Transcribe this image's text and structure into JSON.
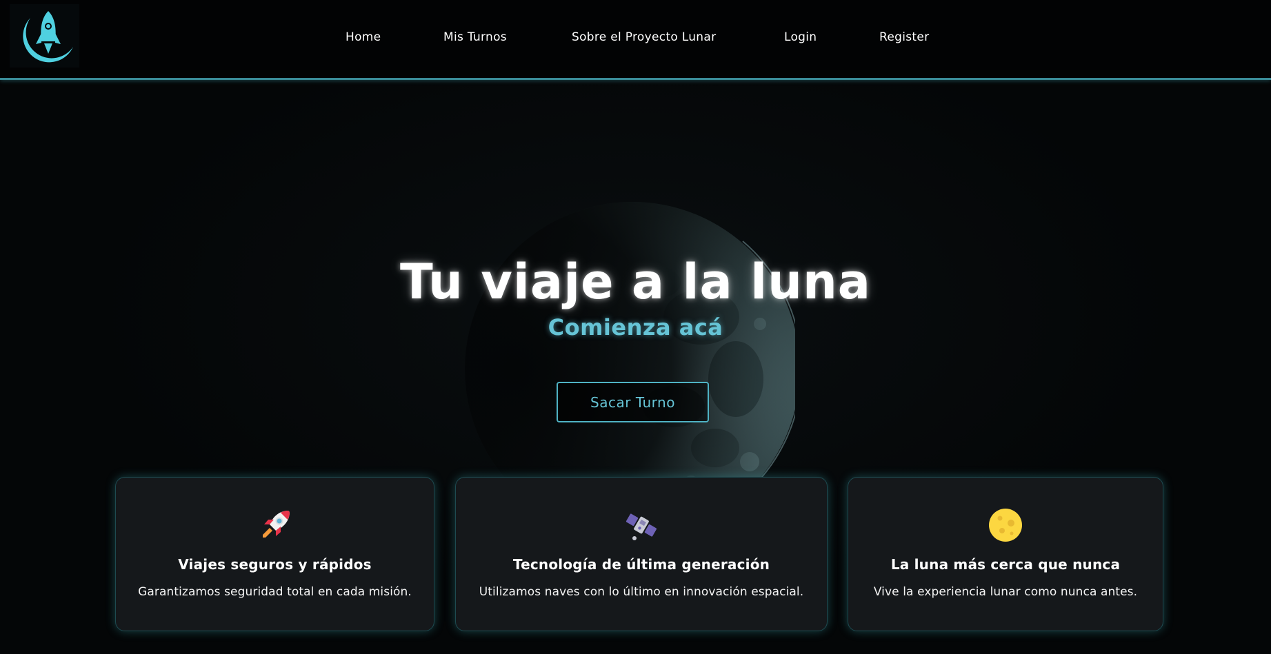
{
  "header": {
    "logo": {
      "icon": "rocket-moon-logo",
      "color": "#4fd0e0"
    },
    "nav": [
      {
        "label": "Home"
      },
      {
        "label": "Mis Turnos"
      },
      {
        "label": "Sobre el Proyecto Lunar"
      },
      {
        "label": "Login"
      },
      {
        "label": "Register"
      }
    ],
    "accent_line_color": "#3a8c98"
  },
  "hero": {
    "title": "Tu viaje a la luna",
    "subtitle": "Comienza acá",
    "cta_label": "Sacar Turno",
    "background_image": "moon-icon"
  },
  "features": [
    {
      "icon": "rocket-icon",
      "title": "Viajes seguros y rápidos",
      "text": "Garantizamos seguridad total en cada misión."
    },
    {
      "icon": "satellite-icon",
      "title": "Tecnología de última generación",
      "text": "Utilizamos naves con lo último en innovación espacial."
    },
    {
      "icon": "full-moon-icon",
      "title": "La luna más cerca que nunca",
      "text": "Vive la experiencia lunar como nunca antes."
    }
  ],
  "colors": {
    "accent": "#66c4d6",
    "background": "#040607",
    "card": "#15181b"
  }
}
